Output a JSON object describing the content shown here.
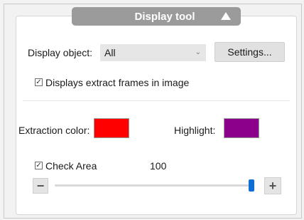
{
  "header": {
    "title": "Display tool",
    "collapse_icon": "triangle-up-icon"
  },
  "display_object": {
    "label": "Display object:",
    "selected": "All",
    "chevron": "⌄",
    "settings_label": "Settings..."
  },
  "extract_frames": {
    "checked": true,
    "check_glyph": "✓",
    "label": "Displays extract frames in image"
  },
  "colors": {
    "extraction_label": "Extraction color:",
    "extraction_value": "#ff0000",
    "highlight_label": "Highlight:",
    "highlight_value": "#8b008b"
  },
  "check_area": {
    "checked": true,
    "check_glyph": "✓",
    "label": "Check Area",
    "value": "100",
    "minus": "−",
    "plus": "+",
    "slider_fraction": 1.0
  }
}
